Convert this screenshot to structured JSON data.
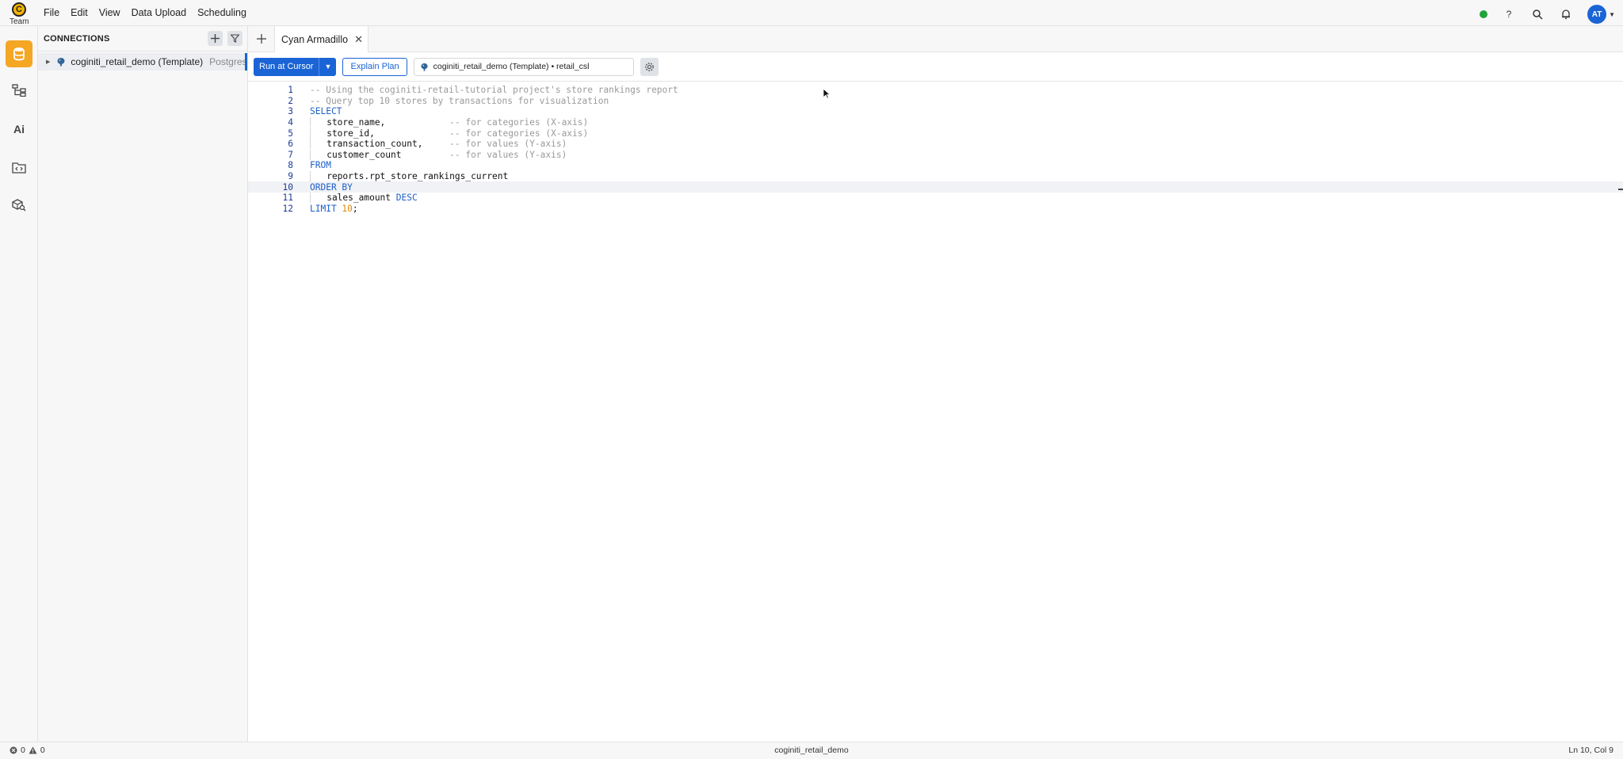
{
  "app": {
    "logo_letter": "C",
    "workspace_label": "Team"
  },
  "menu": [
    "File",
    "Edit",
    "View",
    "Data Upload",
    "Scheduling"
  ],
  "header": {
    "avatar_initials": "AT",
    "status_color": "#22a33a"
  },
  "connections": {
    "title": "CONNECTIONS",
    "items": [
      {
        "name": "coginiti_retail_demo (Template)",
        "type": "Postgres"
      }
    ]
  },
  "tabs": [
    {
      "label": "Cyan Armadillo"
    }
  ],
  "toolbar": {
    "run_label": "Run at Cursor",
    "explain_label": "Explain Plan",
    "connection_value": "coginiti_retail_demo (Template) • retail_csl"
  },
  "editor": {
    "current_line": 10,
    "lines": [
      [
        [
          "cm",
          "-- Using the coginiti-retail-tutorial project's store rankings report"
        ]
      ],
      [
        [
          "cm",
          "-- Query top 10 stores by transactions for visualization"
        ]
      ],
      [
        [
          "kw",
          "SELECT"
        ]
      ],
      [
        [
          "g",
          ""
        ],
        [
          "t",
          "   store_name,            "
        ],
        [
          "cm",
          "-- for categories (X-axis)"
        ]
      ],
      [
        [
          "g",
          ""
        ],
        [
          "t",
          "   store_id,              "
        ],
        [
          "cm",
          "-- for categories (X-axis)"
        ]
      ],
      [
        [
          "g",
          ""
        ],
        [
          "t",
          "   transaction_count,     "
        ],
        [
          "cm",
          "-- for values (Y-axis)"
        ]
      ],
      [
        [
          "g",
          ""
        ],
        [
          "t",
          "   customer_count         "
        ],
        [
          "cm",
          "-- for values (Y-axis)"
        ]
      ],
      [
        [
          "kw",
          "FROM"
        ]
      ],
      [
        [
          "g",
          ""
        ],
        [
          "t",
          "   reports.rpt_store_rankings_current"
        ]
      ],
      [
        [
          "kw",
          "ORDER BY"
        ]
      ],
      [
        [
          "g",
          ""
        ],
        [
          "t",
          "   sales_amount "
        ],
        [
          "kw",
          "DESC"
        ]
      ],
      [
        [
          "kw",
          "LIMIT "
        ],
        [
          "num",
          "10"
        ],
        [
          "t",
          ";"
        ]
      ]
    ]
  },
  "statusbar": {
    "errors": "0",
    "warnings": "0",
    "connection": "coginiti_retail_demo",
    "position": "Ln 10, Col 9"
  }
}
